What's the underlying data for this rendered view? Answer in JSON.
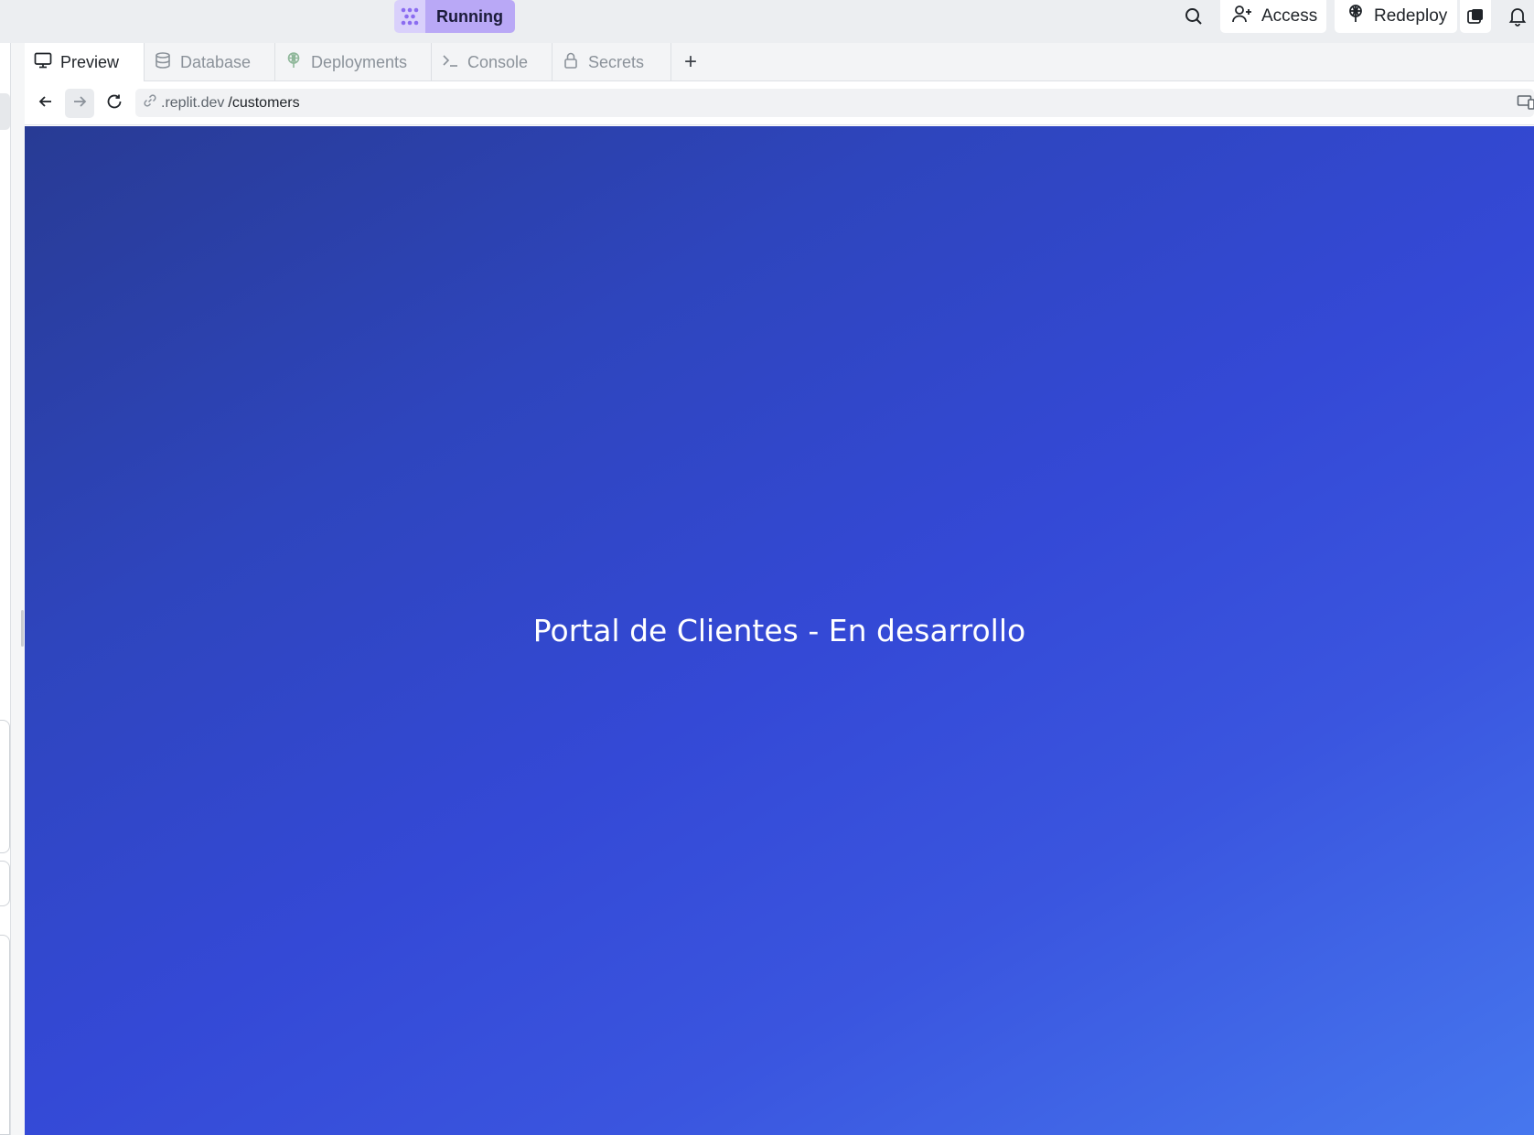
{
  "topbar": {
    "run_label": "Running",
    "access_label": "Access",
    "redeploy_label": "Redeploy",
    "icons": [
      "run-icon",
      "search-icon",
      "user-plus-icon",
      "redeploy-icon",
      "square-icon",
      "bell-icon"
    ]
  },
  "tabs": [
    {
      "label": "Preview",
      "icon": "monitor-icon",
      "active": true
    },
    {
      "label": "Database",
      "icon": "database-icon",
      "active": false
    },
    {
      "label": "Deployments",
      "icon": "deploy-icon",
      "active": false
    },
    {
      "label": "Console",
      "icon": "terminal-icon",
      "active": false
    },
    {
      "label": "Secrets",
      "icon": "lock-icon",
      "active": false
    }
  ],
  "add_tab_label": "+",
  "urlbar": {
    "domain": ".replit.dev",
    "path": "/customers"
  },
  "preview": {
    "heading": "Portal de Clientes - En desarrollo"
  },
  "colors": {
    "running_bg": "#b9a8f6",
    "preview_gradient_start": "#283b94",
    "preview_gradient_end": "#4677ee"
  }
}
